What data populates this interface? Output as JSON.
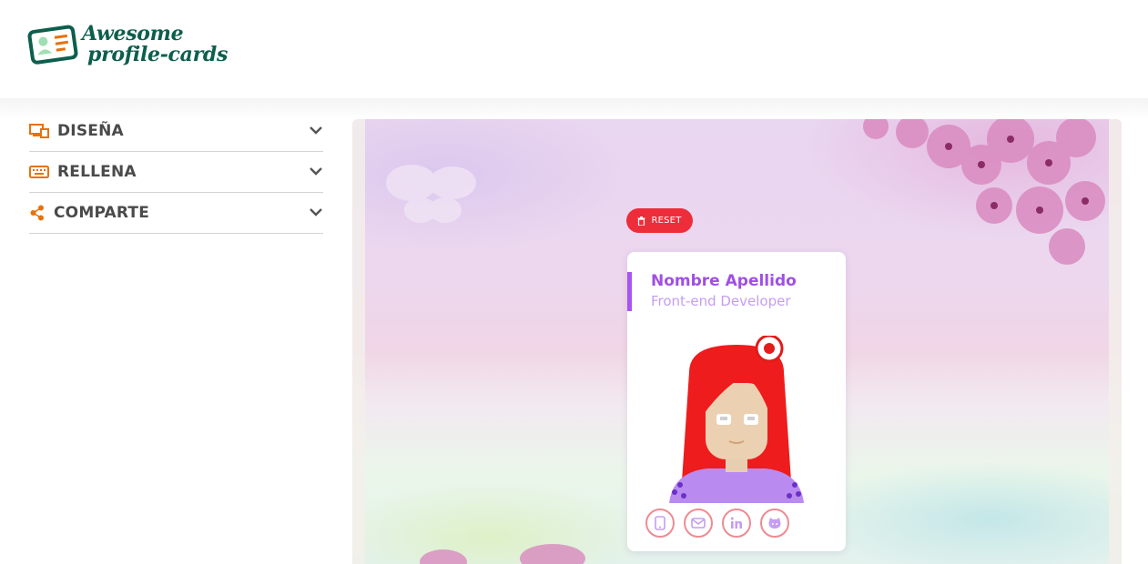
{
  "app": {
    "logo_line1": "Awesome",
    "logo_line2": "profile-cards"
  },
  "sidebar": {
    "sections": [
      {
        "label": "DISEÑA",
        "icon": "design-screen-icon"
      },
      {
        "label": "RELLENA",
        "icon": "keyboard-icon"
      },
      {
        "label": "COMPARTE",
        "icon": "share-icon"
      }
    ]
  },
  "preview": {
    "reset_label": "RESET",
    "card": {
      "name": "Nombre Apellido",
      "job": "Front-end Developer",
      "socials": [
        "phone-icon",
        "email-icon",
        "linkedin-icon",
        "github-icon"
      ]
    }
  },
  "colors": {
    "brand": "#0d5e4d",
    "accent_orange": "#e8710a",
    "card_purple": "#a14ee3",
    "reset_red": "#ee2d3a",
    "social_border": "#f08a92"
  }
}
